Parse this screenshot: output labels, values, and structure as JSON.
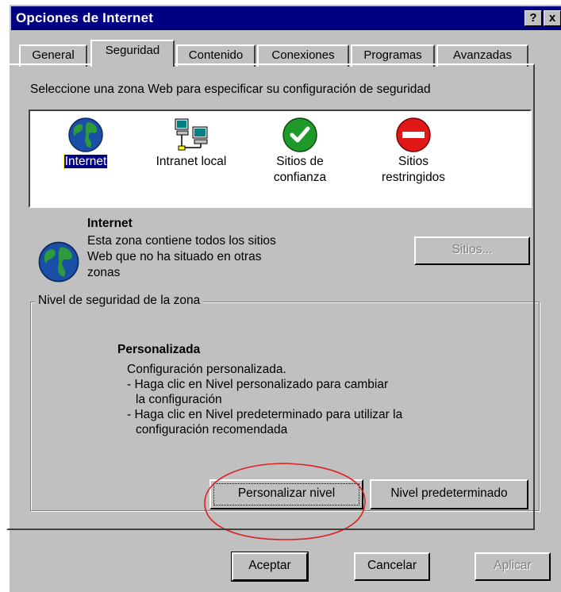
{
  "window": {
    "title": "Opciones de Internet",
    "help_glyph": "?",
    "close_glyph": "x"
  },
  "tabs": [
    {
      "label": "General",
      "active": false
    },
    {
      "label": "Seguridad",
      "active": true
    },
    {
      "label": "Contenido",
      "active": false
    },
    {
      "label": "Conexiones",
      "active": false
    },
    {
      "label": "Programas",
      "active": false
    },
    {
      "label": "Avanzadas",
      "active": false
    }
  ],
  "security": {
    "prompt": "Seleccione una zona Web para especificar su configuración de seguridad",
    "zones": [
      {
        "label": "Internet",
        "icon": "globe-icon",
        "selected": true
      },
      {
        "label": "Intranet local",
        "icon": "computer-network-icon",
        "selected": false
      },
      {
        "label_line1": "Sitios de",
        "label_line2": "confianza",
        "icon": "green-check-icon",
        "selected": false
      },
      {
        "label_line1": "Sitios",
        "label_line2": "restringidos",
        "icon": "red-no-entry-icon",
        "selected": false
      }
    ],
    "zone_info": {
      "title": "Internet",
      "description_line1": "Esta zona contiene todos los sitios",
      "description_line2": "Web que no ha situado en otras",
      "description_line3": "zonas"
    },
    "sites_button": "Sitios...",
    "level_group": {
      "legend": "Nivel de seguridad de la zona",
      "level_name": "Personalizada",
      "desc_line1": "Configuración personalizada.",
      "desc_line2": "- Haga clic en Nivel personalizado para cambiar",
      "desc_line3": "la configuración",
      "desc_line4": "- Haga clic en Nivel predeterminado para utilizar la",
      "desc_line5": "configuración recomendada",
      "custom_button": "Personalizar nivel",
      "default_button": "Nivel predeterminado"
    }
  },
  "footer": {
    "ok": "Aceptar",
    "cancel": "Cancelar",
    "apply": "Aplicar"
  },
  "colors": {
    "titlebar": "#000080",
    "face": "#c0c0c0",
    "selection": "#000080",
    "annotation_oval": "#e02020"
  }
}
